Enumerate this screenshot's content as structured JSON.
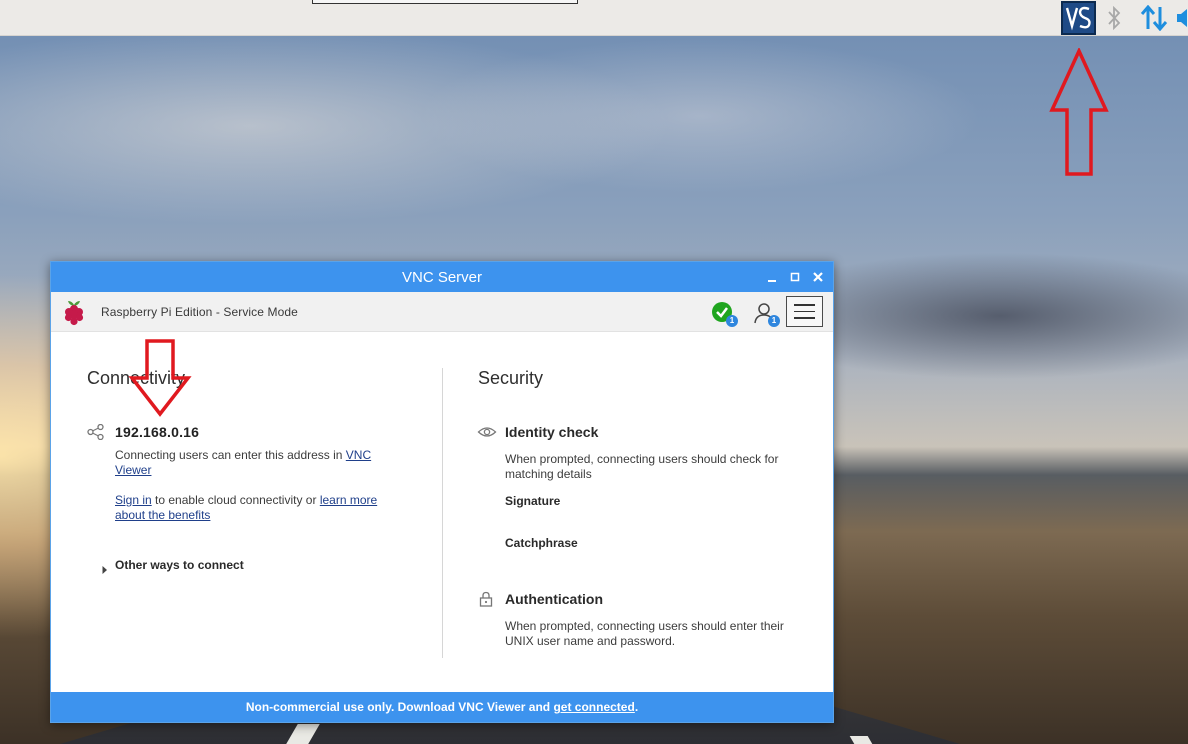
{
  "taskbar": {
    "tray": {
      "vnc_icon": "vnc-tray-icon",
      "bluetooth_icon": "bluetooth-icon",
      "network_icon": "network-transfer-icon",
      "volume_icon": "volume-icon"
    }
  },
  "window": {
    "title": "VNC Server",
    "controls": {
      "minimize": "minimize-icon",
      "maximize": "maximize-icon",
      "close": "close-icon"
    },
    "edition": "Raspberry Pi Edition - Service Mode",
    "status_badge_count": "1",
    "users_badge_count": "1",
    "menu_icon": "hamburger-menu-icon"
  },
  "connectivity": {
    "heading": "Connectivity",
    "ip_address": "192.168.0.16",
    "description_prefix": "Connecting users can enter this address in ",
    "description_link": "VNC Viewer",
    "signin_link": "Sign in",
    "signin_middle": " to enable cloud connectivity or ",
    "learn_more_link": "learn more about the benefits",
    "other_ways": "Other ways to connect"
  },
  "security": {
    "heading": "Security",
    "identity_heading": "Identity check",
    "identity_desc": "When prompted, connecting users should check for matching details",
    "signature_label": "Signature",
    "catchphrase_label": "Catchphrase",
    "auth_heading": "Authentication",
    "auth_desc": "When prompted, connecting users should enter their UNIX user name and password."
  },
  "footer": {
    "text": "Non-commercial use only. Download VNC Viewer and ",
    "link": "get connected",
    "suffix": "."
  },
  "colors": {
    "titlebar": "#3d93ee",
    "annotation_arrow": "#e0191f",
    "status_ok": "#1fa51f"
  }
}
